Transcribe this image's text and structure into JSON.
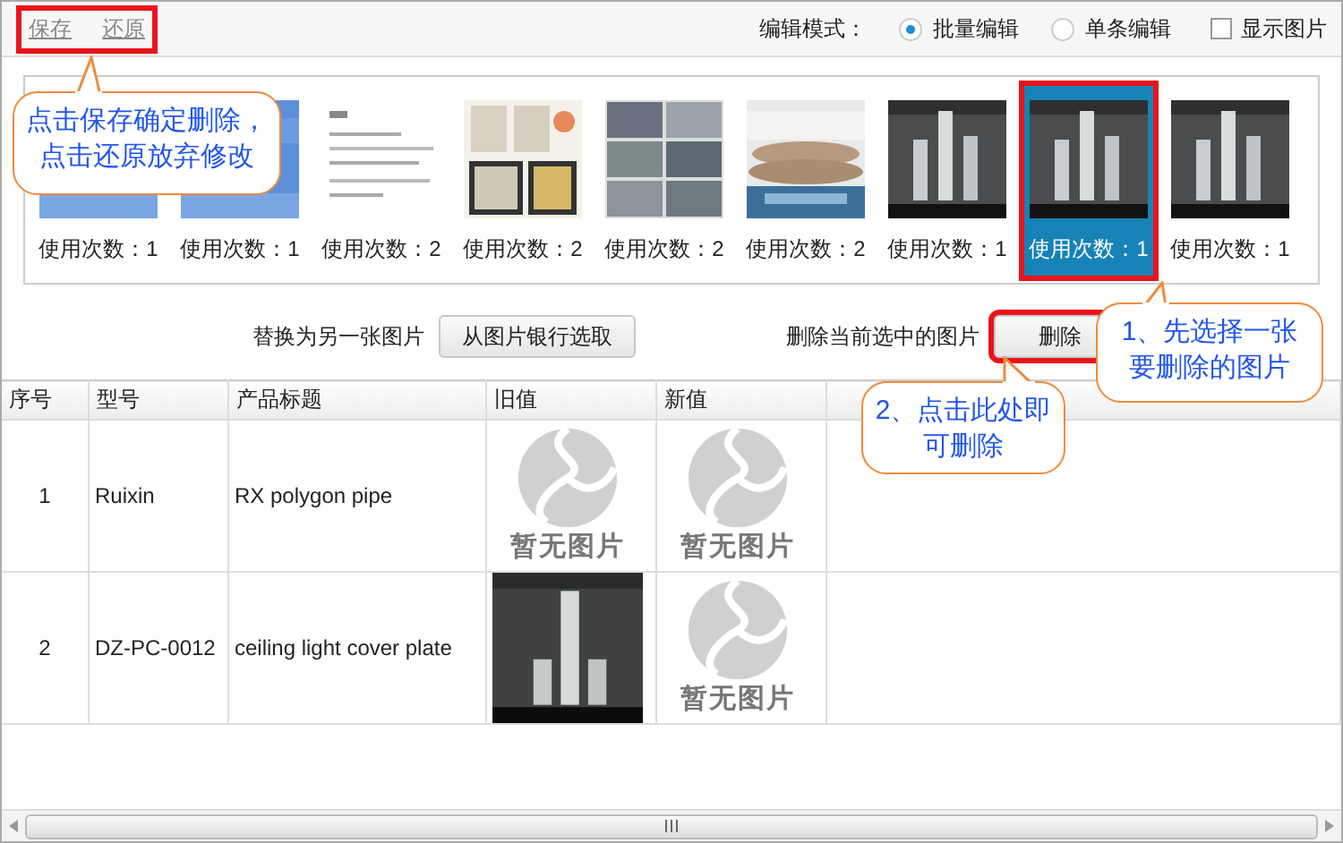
{
  "toolbar": {
    "links": [
      {
        "label": "保存"
      },
      {
        "label": "还原"
      }
    ],
    "highlighted": true,
    "mode_label": "编辑模式：",
    "modes": [
      {
        "label": "批量编辑",
        "selected": true
      },
      {
        "label": "单条编辑",
        "selected": false
      }
    ],
    "show_images": {
      "label": "显示图片",
      "checked": false
    }
  },
  "thumbnails": [
    {
      "usage": "使用次数：1",
      "selected": false,
      "highlighted": false
    },
    {
      "usage": "使用次数：1",
      "selected": false,
      "highlighted": false
    },
    {
      "usage": "使用次数：2",
      "selected": false,
      "highlighted": false
    },
    {
      "usage": "使用次数：2",
      "selected": false,
      "highlighted": false
    },
    {
      "usage": "使用次数：2",
      "selected": false,
      "highlighted": false
    },
    {
      "usage": "使用次数：2",
      "selected": false,
      "highlighted": false
    },
    {
      "usage": "使用次数：1",
      "selected": false,
      "highlighted": false
    },
    {
      "usage": "使用次数：1",
      "selected": true,
      "highlighted": true
    },
    {
      "usage": "使用次数：1",
      "selected": false,
      "highlighted": false
    }
  ],
  "replace": {
    "label": "替换为另一张图片",
    "button": "从图片银行选取"
  },
  "delete": {
    "label": "删除当前选中的图片",
    "button": "删除",
    "highlighted": true
  },
  "table": {
    "columns": [
      "序号",
      "型号",
      "产品标题",
      "旧值",
      "新值"
    ],
    "rows": [
      {
        "cells": [
          "1",
          "Ruixin",
          "RX polygon pipe"
        ],
        "old": {
          "kind": "placeholder",
          "text": "暂无图片"
        },
        "new": {
          "kind": "placeholder",
          "text": "暂无图片"
        }
      },
      {
        "cells": [
          "2",
          "DZ-PC-0012",
          "ceiling light cover plate"
        ],
        "new": {
          "kind": "placeholder",
          "text": "暂无图片"
        }
      }
    ]
  },
  "callouts": [
    {
      "lines": [
        "点击保存确定删除，",
        "点击还原放弃修改"
      ]
    },
    {
      "lines": [
        "1、先选择一张",
        "要删除的图片"
      ]
    },
    {
      "lines": [
        "2、点击此处即",
        "可删除"
      ]
    }
  ]
}
